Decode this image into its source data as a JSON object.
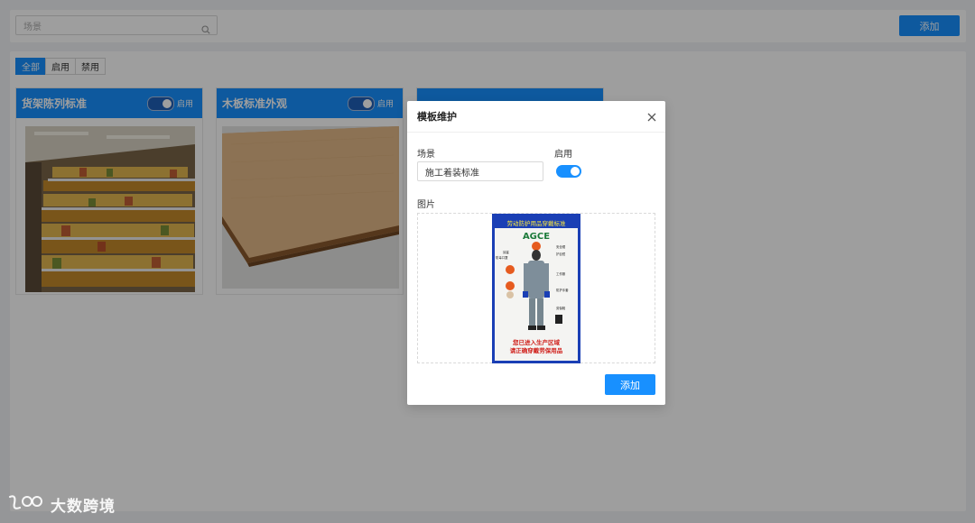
{
  "search": {
    "placeholder": "场景"
  },
  "toolbar": {
    "add_label": "添加"
  },
  "filters": [
    {
      "label": "全部",
      "active": true
    },
    {
      "label": "启用",
      "active": false
    },
    {
      "label": "禁用",
      "active": false
    }
  ],
  "cards": [
    {
      "title": "货架陈列标准",
      "switch_label": "启用"
    },
    {
      "title": "木板标准外观",
      "switch_label": "启用"
    }
  ],
  "modal": {
    "title": "模板维护",
    "scene_label": "场景",
    "scene_value": "施工着装标准",
    "enable_label": "启用",
    "image_label": "图片",
    "add_label": "添加",
    "poster": {
      "header": "劳动防护用品穿戴标准",
      "brand": "AGCE",
      "labels": [
        "耳塞",
        "防毒口罩",
        "安全帽",
        "护目镜",
        "工作服",
        "防护手套",
        "劳保鞋"
      ],
      "footer_line1": "您已进入生产区域",
      "footer_line2": "请正确穿戴劳保用品"
    }
  },
  "watermark": {
    "text": "大数跨境"
  },
  "colors": {
    "primary": "#1890ff",
    "mask": "rgba(0,0,0,0.38)"
  }
}
